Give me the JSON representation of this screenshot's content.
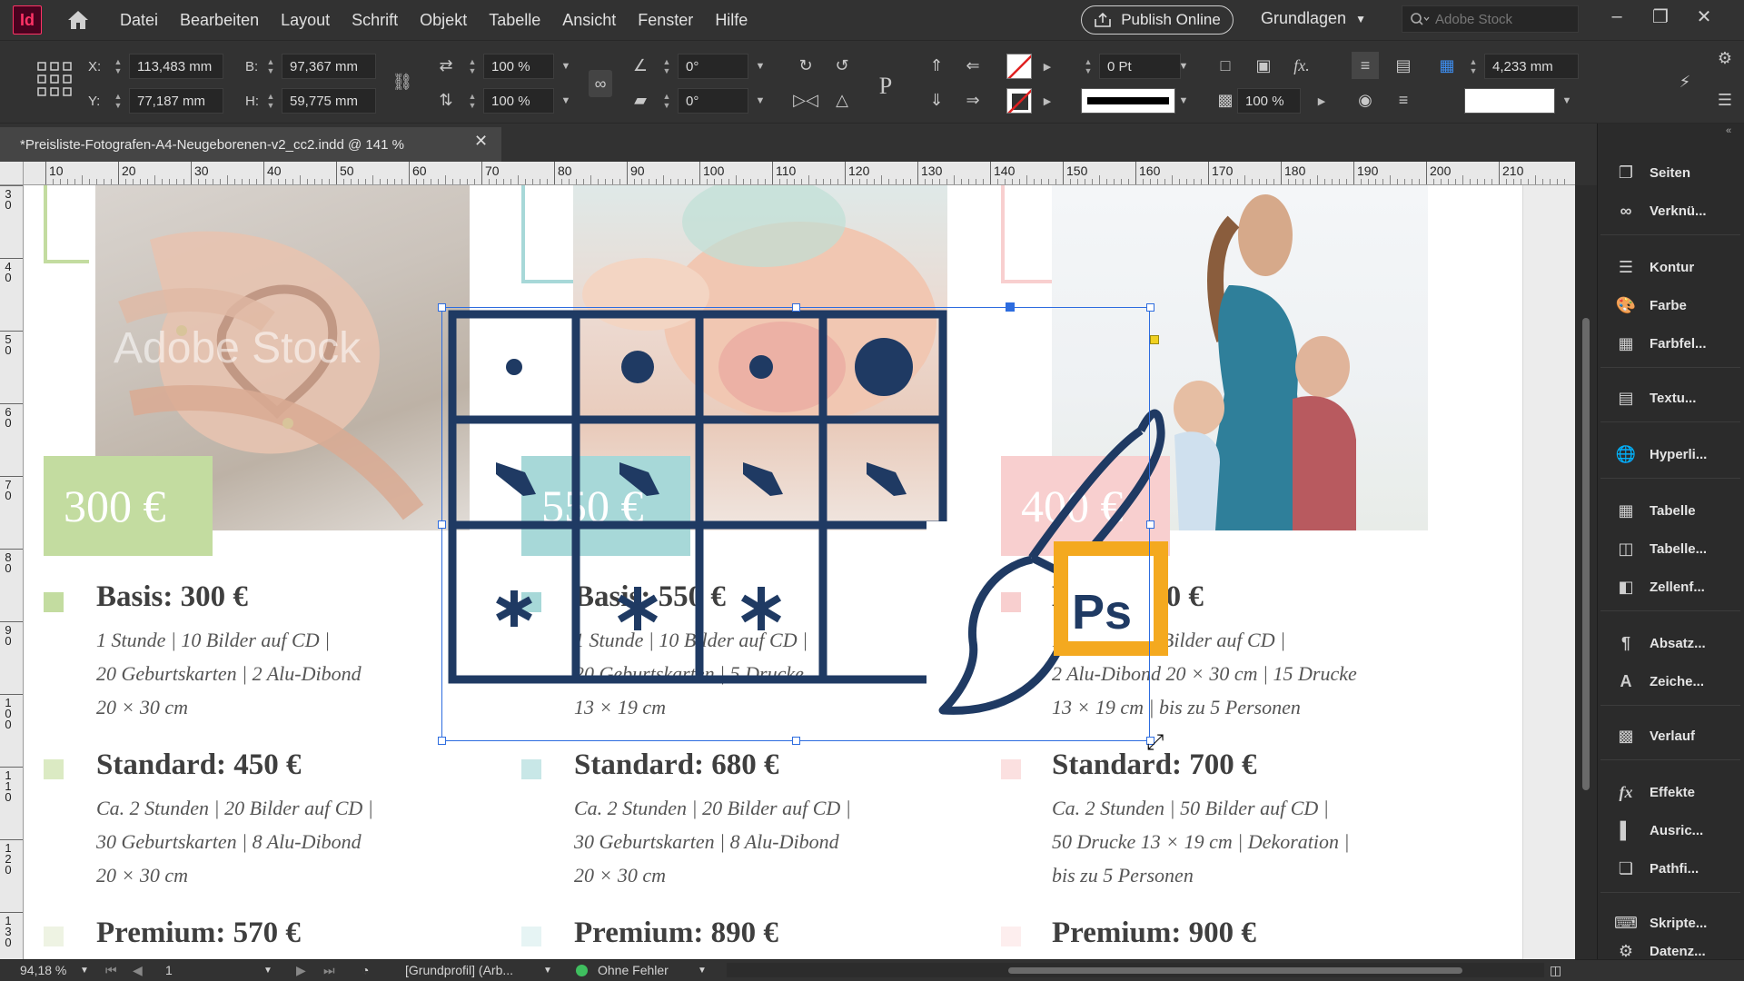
{
  "app": {
    "logo": "Id"
  },
  "menu": [
    "Datei",
    "Bearbeiten",
    "Layout",
    "Schrift",
    "Objekt",
    "Tabelle",
    "Ansicht",
    "Fenster",
    "Hilfe"
  ],
  "publish_label": "Publish Online",
  "workspace": "Grundlagen",
  "search_placeholder": "Adobe Stock",
  "control": {
    "x_label": "X:",
    "x_value": "113,483 mm",
    "y_label": "Y:",
    "y_value": "77,187 mm",
    "w_label": "B:",
    "w_value": "97,367 mm",
    "h_label": "H:",
    "h_value": "59,775 mm",
    "scale_x": "100 %",
    "scale_y": "100 %",
    "rotate": "0°",
    "shear": "0°",
    "stroke_weight": "0 Pt",
    "opacity": "100 %",
    "gap": "4,233 mm"
  },
  "document_tab": "*Preisliste-Fotografen-A4-Neugeborenen-v2_cc2.indd @ 141 %",
  "ruler_top": [
    "10",
    "20",
    "30",
    "40",
    "50",
    "60",
    "70",
    "80",
    "90",
    "100",
    "110",
    "120",
    "130",
    "140",
    "150",
    "160",
    "170",
    "180",
    "190",
    "200",
    "210"
  ],
  "ruler_left": [
    "3\n0",
    "4\n0",
    "5\n0",
    "6\n0",
    "7\n0",
    "8\n0",
    "9\n0",
    "1\n0\n0",
    "1\n1\n0",
    "1\n2\n0",
    "1\n3\n0"
  ],
  "watermark": "Adobe Stock",
  "ps_logo": "Ps",
  "columns": [
    {
      "price": "300 €",
      "basis": "Basis: 300 €",
      "basis_lines": [
        "1 Stunde | 10 Bilder auf CD |",
        "20 Geburtskarten | 2 Alu-Dibond",
        "20 × 30 cm"
      ],
      "standard": "Standard: 450 €",
      "standard_lines": [
        "Ca. 2 Stunden | 20 Bilder auf CD |",
        "30 Geburtskarten | 8 Alu-Dibond",
        "20 × 30 cm"
      ],
      "premium": "Premium: 570 €"
    },
    {
      "price": "550 €",
      "basis": "Basis: 550 €",
      "basis_lines": [
        "1 Stunde | 10 Bilder auf CD |",
        "20 Geburtskarten | 5 Drucke",
        "13 × 19 cm"
      ],
      "standard": "Standard: 680 €",
      "standard_lines": [
        "Ca. 2 Stunden | 20 Bilder auf CD |",
        "30 Geburtskarten | 8 Alu-Dibond",
        "20 × 30 cm"
      ],
      "premium": "Premium: 890 €"
    },
    {
      "price": "400 €",
      "basis": "Basis: 400 €",
      "basis_lines": [
        "1 Stunde | 25 Bilder auf CD |",
        "2 Alu-Dibond 20 × 30 cm | 15 Drucke",
        "13 × 19 cm | bis zu 5 Personen"
      ],
      "standard": "Standard: 700 €",
      "standard_lines": [
        "Ca. 2 Stunden | 50 Bilder auf CD |",
        "50 Drucke 13 × 19 cm | Dekoration |",
        "bis zu 5 Personen"
      ],
      "premium": "Premium: 900 €"
    }
  ],
  "colors": {
    "green": "#c3dca0",
    "teal": "#a7d8d8",
    "pink": "#f8cfcf",
    "navy": "#1f3a63",
    "ps_orange": "#f4a91f",
    "selection": "#2d6cdf"
  },
  "panels": [
    "Seiten",
    "Verknü...",
    "Kontur",
    "Farbe",
    "Farbfel...",
    "Textu...",
    "Hyperli...",
    "Tabelle",
    "Tabelle...",
    "Zellenf...",
    "Absatz...",
    "Zeiche...",
    "Verlauf",
    "Effekte",
    "Ausric...",
    "Pathfi...",
    "Skripte...",
    "Datenz..."
  ],
  "status": {
    "zoom": "94,18 %",
    "page": "1",
    "profile": "[Grundprofil] (Arb...",
    "preflight": "Ohne Fehler"
  }
}
